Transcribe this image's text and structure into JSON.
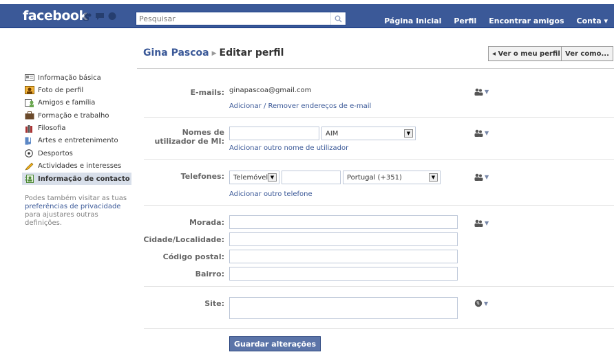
{
  "topbar": {
    "logo": "facebook",
    "search_placeholder": "Pesquisar",
    "nav": [
      "Página Inicial",
      "Perfil",
      "Encontrar amigos",
      "Conta ▾"
    ]
  },
  "header": {
    "name": "Gina Pascoa",
    "page": "Editar perfil",
    "view_profile_btn": "◂ Ver o meu perfil",
    "view_as_btn": "Ver como..."
  },
  "sidebar": {
    "items": [
      {
        "label": "Informação básica",
        "icon": "id-card-icon"
      },
      {
        "label": "Foto de perfil",
        "icon": "photo-icon"
      },
      {
        "label": "Amigos e família",
        "icon": "friends-icon"
      },
      {
        "label": "Formação e trabalho",
        "icon": "briefcase-icon"
      },
      {
        "label": "Filosofia",
        "icon": "books-icon"
      },
      {
        "label": "Artes e entretenimento",
        "icon": "music-icon"
      },
      {
        "label": "Desportos",
        "icon": "soccer-ball-icon"
      },
      {
        "label": "Actividades e interesses",
        "icon": "pencil-icon"
      },
      {
        "label": "Informação de contacto",
        "icon": "contact-icon",
        "active": true
      }
    ],
    "note_pre": "Podes também visitar as tuas ",
    "note_link": "preferências de privacidade",
    "note_post": " para ajustares outras definições."
  },
  "form": {
    "emails": {
      "label": "E-mails:",
      "value": "ginapascoa@gmail.com",
      "link": "Adicionar / Remover endereços de e-mail"
    },
    "im": {
      "label": "Nomes de utilizador de MI:",
      "service": "AIM",
      "link": "Adicionar outro nome de utilizador"
    },
    "phones": {
      "label": "Telefones:",
      "type": "Telemóvel",
      "country": "Portugal (+351)",
      "link": "Adicionar outro telefone"
    },
    "address": {
      "morada_label": "Morada:",
      "cidade_label": "Cidade/Localidade:",
      "codigo_label": "Código postal:",
      "bairro_label": "Bairro:"
    },
    "site": {
      "label": "Site:"
    },
    "save_label": "Guardar alterações"
  },
  "colors": {
    "brand": "#3b5998",
    "button": "#5b74a8"
  }
}
